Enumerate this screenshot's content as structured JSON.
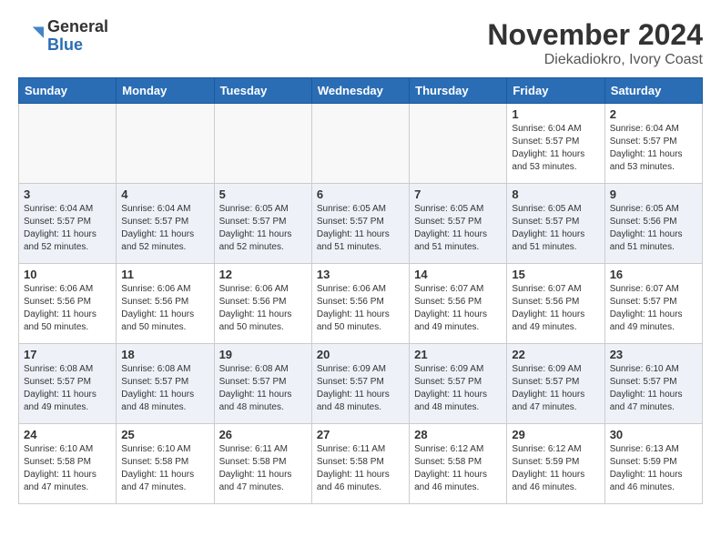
{
  "header": {
    "logo": {
      "line1": "General",
      "line2": "Blue"
    },
    "month_year": "November 2024",
    "location": "Diekadiokro, Ivory Coast"
  },
  "weekdays": [
    "Sunday",
    "Monday",
    "Tuesday",
    "Wednesday",
    "Thursday",
    "Friday",
    "Saturday"
  ],
  "weeks": [
    [
      {
        "day": "",
        "info": ""
      },
      {
        "day": "",
        "info": ""
      },
      {
        "day": "",
        "info": ""
      },
      {
        "day": "",
        "info": ""
      },
      {
        "day": "",
        "info": ""
      },
      {
        "day": "1",
        "info": "Sunrise: 6:04 AM\nSunset: 5:57 PM\nDaylight: 11 hours\nand 53 minutes."
      },
      {
        "day": "2",
        "info": "Sunrise: 6:04 AM\nSunset: 5:57 PM\nDaylight: 11 hours\nand 53 minutes."
      }
    ],
    [
      {
        "day": "3",
        "info": "Sunrise: 6:04 AM\nSunset: 5:57 PM\nDaylight: 11 hours\nand 52 minutes."
      },
      {
        "day": "4",
        "info": "Sunrise: 6:04 AM\nSunset: 5:57 PM\nDaylight: 11 hours\nand 52 minutes."
      },
      {
        "day": "5",
        "info": "Sunrise: 6:05 AM\nSunset: 5:57 PM\nDaylight: 11 hours\nand 52 minutes."
      },
      {
        "day": "6",
        "info": "Sunrise: 6:05 AM\nSunset: 5:57 PM\nDaylight: 11 hours\nand 51 minutes."
      },
      {
        "day": "7",
        "info": "Sunrise: 6:05 AM\nSunset: 5:57 PM\nDaylight: 11 hours\nand 51 minutes."
      },
      {
        "day": "8",
        "info": "Sunrise: 6:05 AM\nSunset: 5:57 PM\nDaylight: 11 hours\nand 51 minutes."
      },
      {
        "day": "9",
        "info": "Sunrise: 6:05 AM\nSunset: 5:56 PM\nDaylight: 11 hours\nand 51 minutes."
      }
    ],
    [
      {
        "day": "10",
        "info": "Sunrise: 6:06 AM\nSunset: 5:56 PM\nDaylight: 11 hours\nand 50 minutes."
      },
      {
        "day": "11",
        "info": "Sunrise: 6:06 AM\nSunset: 5:56 PM\nDaylight: 11 hours\nand 50 minutes."
      },
      {
        "day": "12",
        "info": "Sunrise: 6:06 AM\nSunset: 5:56 PM\nDaylight: 11 hours\nand 50 minutes."
      },
      {
        "day": "13",
        "info": "Sunrise: 6:06 AM\nSunset: 5:56 PM\nDaylight: 11 hours\nand 50 minutes."
      },
      {
        "day": "14",
        "info": "Sunrise: 6:07 AM\nSunset: 5:56 PM\nDaylight: 11 hours\nand 49 minutes."
      },
      {
        "day": "15",
        "info": "Sunrise: 6:07 AM\nSunset: 5:56 PM\nDaylight: 11 hours\nand 49 minutes."
      },
      {
        "day": "16",
        "info": "Sunrise: 6:07 AM\nSunset: 5:57 PM\nDaylight: 11 hours\nand 49 minutes."
      }
    ],
    [
      {
        "day": "17",
        "info": "Sunrise: 6:08 AM\nSunset: 5:57 PM\nDaylight: 11 hours\nand 49 minutes."
      },
      {
        "day": "18",
        "info": "Sunrise: 6:08 AM\nSunset: 5:57 PM\nDaylight: 11 hours\nand 48 minutes."
      },
      {
        "day": "19",
        "info": "Sunrise: 6:08 AM\nSunset: 5:57 PM\nDaylight: 11 hours\nand 48 minutes."
      },
      {
        "day": "20",
        "info": "Sunrise: 6:09 AM\nSunset: 5:57 PM\nDaylight: 11 hours\nand 48 minutes."
      },
      {
        "day": "21",
        "info": "Sunrise: 6:09 AM\nSunset: 5:57 PM\nDaylight: 11 hours\nand 48 minutes."
      },
      {
        "day": "22",
        "info": "Sunrise: 6:09 AM\nSunset: 5:57 PM\nDaylight: 11 hours\nand 47 minutes."
      },
      {
        "day": "23",
        "info": "Sunrise: 6:10 AM\nSunset: 5:57 PM\nDaylight: 11 hours\nand 47 minutes."
      }
    ],
    [
      {
        "day": "24",
        "info": "Sunrise: 6:10 AM\nSunset: 5:58 PM\nDaylight: 11 hours\nand 47 minutes."
      },
      {
        "day": "25",
        "info": "Sunrise: 6:10 AM\nSunset: 5:58 PM\nDaylight: 11 hours\nand 47 minutes."
      },
      {
        "day": "26",
        "info": "Sunrise: 6:11 AM\nSunset: 5:58 PM\nDaylight: 11 hours\nand 47 minutes."
      },
      {
        "day": "27",
        "info": "Sunrise: 6:11 AM\nSunset: 5:58 PM\nDaylight: 11 hours\nand 46 minutes."
      },
      {
        "day": "28",
        "info": "Sunrise: 6:12 AM\nSunset: 5:58 PM\nDaylight: 11 hours\nand 46 minutes."
      },
      {
        "day": "29",
        "info": "Sunrise: 6:12 AM\nSunset: 5:59 PM\nDaylight: 11 hours\nand 46 minutes."
      },
      {
        "day": "30",
        "info": "Sunrise: 6:13 AM\nSunset: 5:59 PM\nDaylight: 11 hours\nand 46 minutes."
      }
    ]
  ]
}
